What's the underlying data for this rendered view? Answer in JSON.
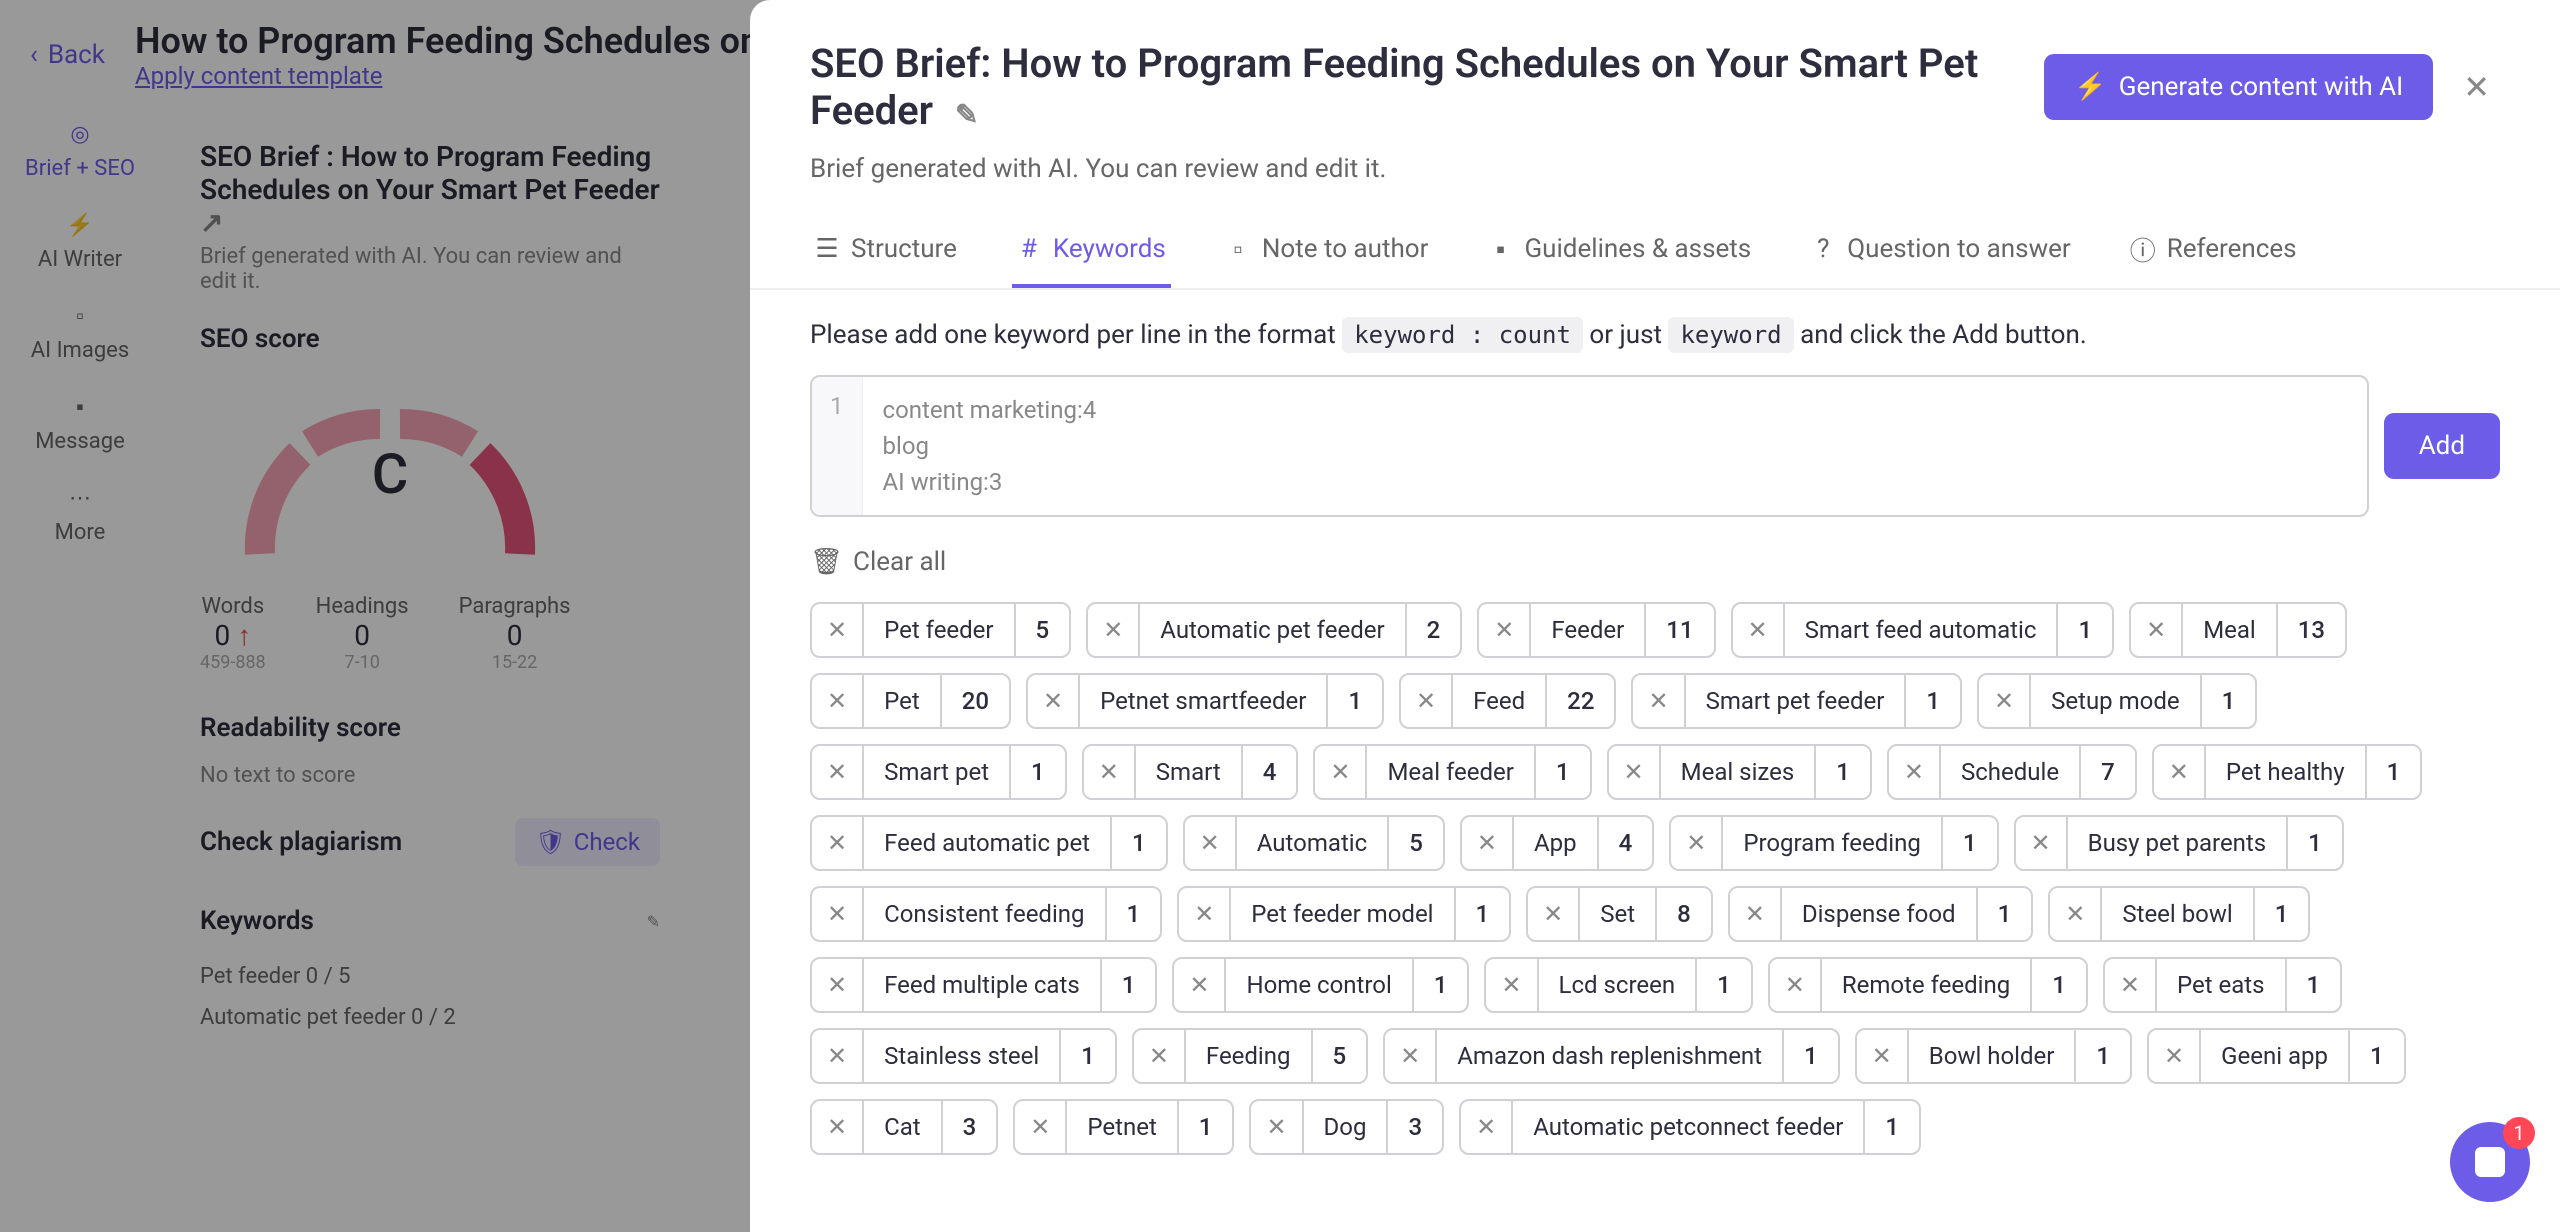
{
  "bg": {
    "back": "Back",
    "title": "How to Program Feeding Schedules on Yo",
    "apply_template": "Apply content template",
    "sidebar": {
      "brief_seo": "Brief + SEO",
      "ai_writer": "AI Writer",
      "ai_images": "AI Images",
      "message": "Message",
      "more": "More"
    },
    "brief_title": "SEO Brief : How to Program Feeding Schedules on Your Smart Pet Feeder",
    "brief_sub": "Brief generated with AI. You can review and edit it.",
    "seo_score": "SEO score",
    "gauge_letter": "C",
    "stats": {
      "words": {
        "label": "Words",
        "value": "0",
        "range": "459-888"
      },
      "headings": {
        "label": "Headings",
        "value": "0",
        "range": "7-10"
      },
      "paragraphs": {
        "label": "Paragraphs",
        "value": "0",
        "range": "15-22"
      }
    },
    "readability": "Readability score",
    "no_text": "No text to score",
    "check_plagiarism": "Check plagiarism",
    "check_btn": "Check",
    "keywords_title": "Keywords",
    "keyword_list": {
      "k1": "Pet feeder   0 / 5",
      "k2": "Automatic pet feeder   0 / 2"
    }
  },
  "modal": {
    "title": "SEO Brief: How to Program Feeding Schedules on Your Smart Pet Feeder",
    "generate_btn": "Generate content with AI",
    "subtitle": "Brief generated with AI. You can review and edit it.",
    "tabs": {
      "structure": "Structure",
      "keywords": "Keywords",
      "note": "Note to author",
      "guidelines": "Guidelines & assets",
      "question": "Question to answer",
      "references": "References"
    },
    "instruction_part1": "Please add one keyword per line in the format",
    "instruction_code1": "keyword : count",
    "instruction_or": "or just",
    "instruction_code2": "keyword",
    "instruction_part2": "and click the Add button.",
    "line_number": "1",
    "placeholder1": "content marketing:4",
    "placeholder2": "blog",
    "placeholder3": "AI writing:3",
    "add_btn": "Add",
    "clear_all": "Clear all",
    "keywords": [
      {
        "label": "Pet feeder",
        "count": "5"
      },
      {
        "label": "Automatic pet feeder",
        "count": "2"
      },
      {
        "label": "Feeder",
        "count": "11"
      },
      {
        "label": "Smart feed automatic",
        "count": "1"
      },
      {
        "label": "Meal",
        "count": "13"
      },
      {
        "label": "Pet",
        "count": "20"
      },
      {
        "label": "Petnet smartfeeder",
        "count": "1"
      },
      {
        "label": "Feed",
        "count": "22"
      },
      {
        "label": "Smart pet feeder",
        "count": "1"
      },
      {
        "label": "Setup mode",
        "count": "1"
      },
      {
        "label": "Smart pet",
        "count": "1"
      },
      {
        "label": "Smart",
        "count": "4"
      },
      {
        "label": "Meal feeder",
        "count": "1"
      },
      {
        "label": "Meal sizes",
        "count": "1"
      },
      {
        "label": "Schedule",
        "count": "7"
      },
      {
        "label": "Pet healthy",
        "count": "1"
      },
      {
        "label": "Feed automatic pet",
        "count": "1"
      },
      {
        "label": "Automatic",
        "count": "5"
      },
      {
        "label": "App",
        "count": "4"
      },
      {
        "label": "Program feeding",
        "count": "1"
      },
      {
        "label": "Busy pet parents",
        "count": "1"
      },
      {
        "label": "Consistent feeding",
        "count": "1"
      },
      {
        "label": "Pet feeder model",
        "count": "1"
      },
      {
        "label": "Set",
        "count": "8"
      },
      {
        "label": "Dispense food",
        "count": "1"
      },
      {
        "label": "Steel bowl",
        "count": "1"
      },
      {
        "label": "Feed multiple cats",
        "count": "1"
      },
      {
        "label": "Home control",
        "count": "1"
      },
      {
        "label": "Lcd screen",
        "count": "1"
      },
      {
        "label": "Remote feeding",
        "count": "1"
      },
      {
        "label": "Pet eats",
        "count": "1"
      },
      {
        "label": "Stainless steel",
        "count": "1"
      },
      {
        "label": "Feeding",
        "count": "5"
      },
      {
        "label": "Amazon dash replenishment",
        "count": "1"
      },
      {
        "label": "Bowl holder",
        "count": "1"
      },
      {
        "label": "Geeni app",
        "count": "1"
      },
      {
        "label": "Cat",
        "count": "3"
      },
      {
        "label": "Petnet",
        "count": "1"
      },
      {
        "label": "Dog",
        "count": "3"
      },
      {
        "label": "Automatic petconnect feeder",
        "count": "1"
      }
    ]
  },
  "intercom": {
    "badge": "1"
  }
}
